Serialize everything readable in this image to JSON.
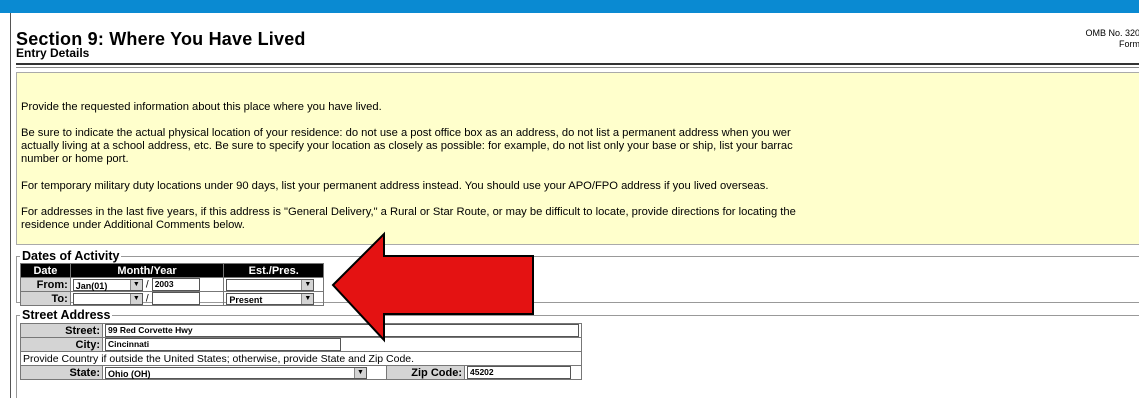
{
  "header": {
    "title": "Section 9: Where You Have Lived",
    "subtitle": "Entry Details",
    "omb_line1": "OMB No. 320",
    "omb_line2": "Form"
  },
  "instructions": [
    "Provide the requested information about this place where you have lived.",
    "Be sure to indicate the actual physical location of your residence: do not use a post office box as an address, do not list a permanent address when you wer",
    "actually living at a school address, etc. Be sure to specify your location as closely as possible: for example, do not list only your base or ship, list your barrac",
    "number or home port.",
    "For temporary military duty locations under 90 days, list your permanent address instead. You should use your APO/FPO address if you lived overseas.",
    "For addresses in the last five years, if this address is \"General Delivery,\" a Rural or Star Route, or may be difficult to locate, provide directions for locating the",
    "residence under Additional Comments below."
  ],
  "dates": {
    "legend": "Dates of Activity",
    "headers": [
      "Date",
      "Month/Year",
      "Est./Pres."
    ],
    "from_label": "From:",
    "to_label": "To:",
    "slash": "/",
    "from_month": "Jan(01)",
    "from_year": "2003",
    "from_est": "",
    "to_month": "",
    "to_year": "",
    "to_est": "Present"
  },
  "address": {
    "legend": "Street Address",
    "street_label": "Street:",
    "street_value": "99 Red Corvette Hwy",
    "city_label": "City:",
    "city_value": "Cincinnati",
    "country_note": "Provide Country if outside the United States; otherwise, provide State and Zip Code.",
    "state_label": "State:",
    "state_value": "Ohio (OH)",
    "zip_label": "Zip Code:",
    "zip_value": "45202"
  },
  "colors": {
    "top_bar": "#0a8ad2",
    "instruction_bg": "#ffffcc",
    "arrow": "#e41212"
  },
  "icons": {
    "dropdown": "▼"
  }
}
